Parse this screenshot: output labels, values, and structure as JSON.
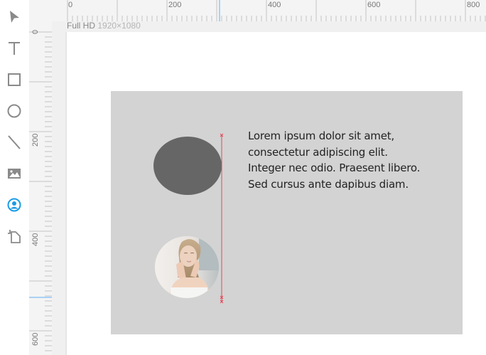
{
  "toolbar": {
    "tools": [
      {
        "name": "select",
        "icon": "pointer-icon",
        "active": false
      },
      {
        "name": "text",
        "icon": "text-tool-icon",
        "active": false
      },
      {
        "name": "rectangle",
        "icon": "rectangle-tool-icon",
        "active": false
      },
      {
        "name": "ellipse",
        "icon": "ellipse-tool-icon",
        "active": false
      },
      {
        "name": "line",
        "icon": "line-tool-icon",
        "active": false
      },
      {
        "name": "image",
        "icon": "image-tool-icon",
        "active": false
      },
      {
        "name": "avatar",
        "icon": "avatar-tool-icon",
        "active": true
      },
      {
        "name": "artboard",
        "icon": "artboard-tool-icon",
        "active": false
      }
    ],
    "active_color": "#1a9be6",
    "icon_color": "#8a8a8a"
  },
  "rulers": {
    "horizontal_labels": [
      "0",
      "200",
      "400",
      "600",
      "800"
    ],
    "vertical_labels": [
      "0",
      "200",
      "400",
      "600"
    ],
    "highlight_color": "#a9d1f5"
  },
  "artboard": {
    "name": "Full HD",
    "dimensions": "1920×1080"
  },
  "canvas": {
    "text_block": {
      "lines": [
        "Lorem ipsum dolor sit amet,",
        "consectetur adipiscing elit.",
        "Integer nec odio. Praesent libero.",
        "Sed cursus ante dapibus diam."
      ]
    },
    "rectangle_color": "#d3d3d3",
    "ellipse_color": "#666666",
    "guide_color": "#e0485a"
  }
}
